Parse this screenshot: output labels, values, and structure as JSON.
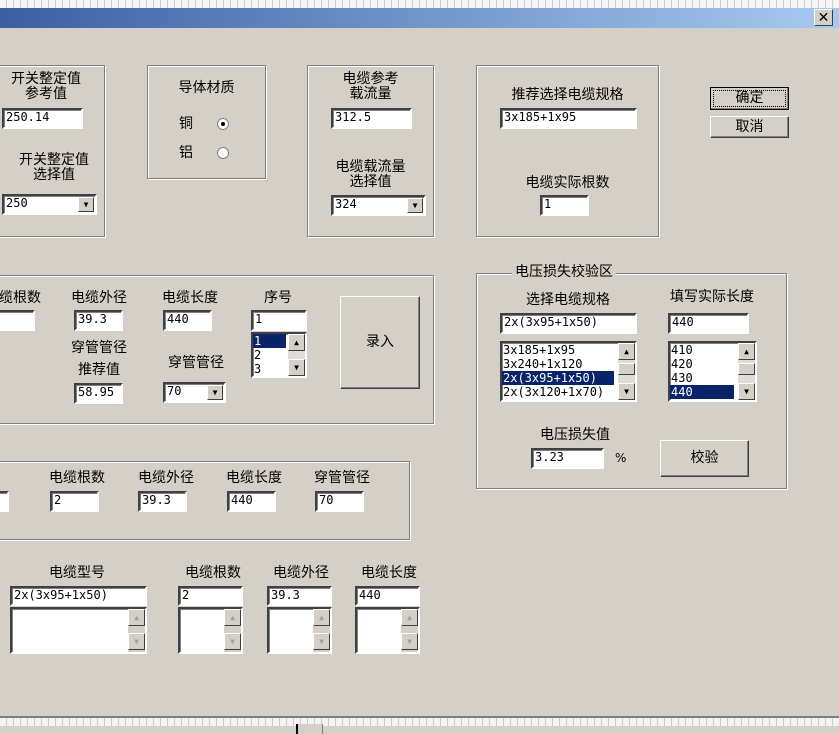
{
  "window": {
    "close": "✕"
  },
  "switch": {
    "ref_label": "开关整定值\n参考值",
    "ref_value": "250.14",
    "sel_label": "开关整定值\n选择值",
    "sel_value": "250"
  },
  "material": {
    "title": "导体材质",
    "copper": "铜",
    "aluminum": "铝",
    "selected": "copper"
  },
  "ampacity": {
    "ref_label": "电缆参考\n载流量",
    "ref_value": "312.5",
    "sel_label": "电缆载流量\n选择值",
    "sel_value": "324"
  },
  "recommend": {
    "spec_label": "推荐选择电缆规格",
    "spec_value": "3x185+1x95",
    "count_label": "电缆实际根数",
    "count_value": "1"
  },
  "buttons": {
    "ok": "确定",
    "cancel": "取消",
    "enter": "录入",
    "check": "校验"
  },
  "entry": {
    "count_label": "缆根数",
    "count_value": "",
    "od_label": "电缆外径",
    "od_value": "39.3",
    "len_label": "电缆长度",
    "len_value": "440",
    "seq_label": "序号",
    "seq_value": "1",
    "seq_items": [
      "1",
      "2",
      "3"
    ],
    "conduit_rec_label1": "穿管管径",
    "conduit_rec_label2": "推荐值",
    "conduit_rec_value": "58.95",
    "conduit_label": "穿管管径",
    "conduit_value": "70"
  },
  "voltage": {
    "title": "电压损失校验区",
    "spec_label": "选择电缆规格",
    "spec_value": "2x(3x95+1x50)",
    "spec_items": [
      "3x185+1x95",
      "3x240+1x120",
      "2x(3x95+1x50)",
      "2x(3x120+1x70)"
    ],
    "len_label": "填写实际长度",
    "len_value": "440",
    "len_items": [
      "410",
      "420",
      "430",
      "440"
    ],
    "loss_label": "电压损失值",
    "loss_value": "3.23",
    "unit": "%"
  },
  "summary": {
    "count_label": "电缆根数",
    "count_value": "2",
    "od_label": "电缆外径",
    "od_value": "39.3",
    "len_label": "电缆长度",
    "len_value": "440",
    "conduit_label": "穿管管径",
    "conduit_value": "70"
  },
  "bottom": {
    "model_label": "电缆型号",
    "model_value": "2x(3x95+1x50)",
    "count_label": "电缆根数",
    "count_value": "2",
    "od_label": "电缆外径",
    "od_value": "39.3",
    "len_label": "电缆长度",
    "len_value": "440"
  }
}
